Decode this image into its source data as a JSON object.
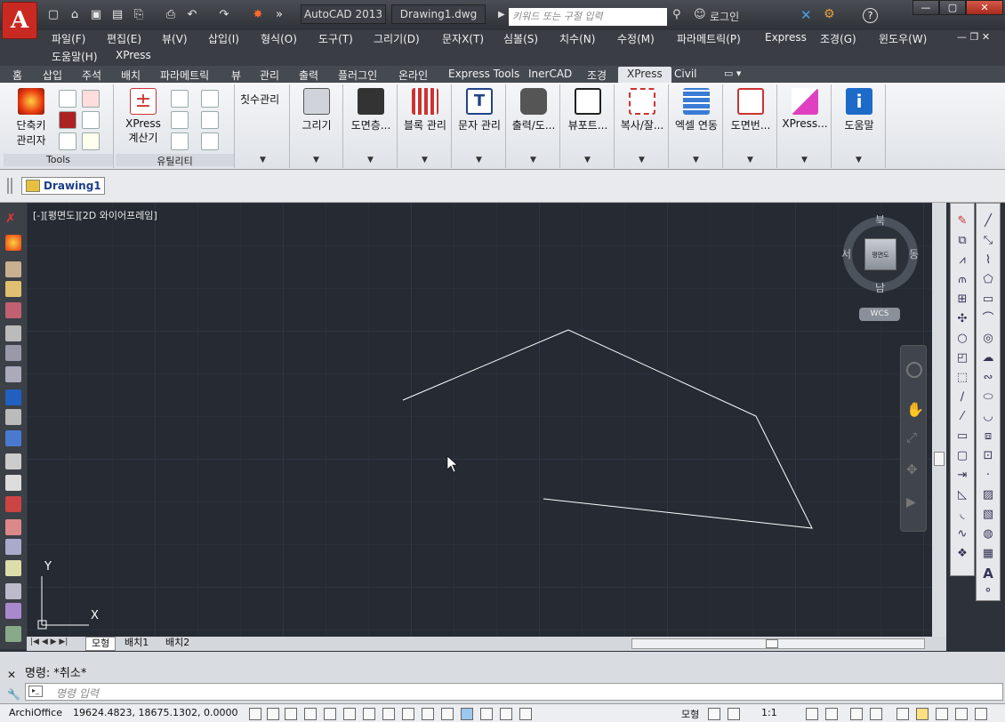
{
  "titlebar": {
    "app_version": "AutoCAD 2013",
    "document": "Drawing1.dwg",
    "search_placeholder": "키워드 또는 구절 입력",
    "login": "로그인",
    "help": "?"
  },
  "menubar": {
    "items": [
      "파일(F)",
      "편집(E)",
      "뷰(V)",
      "삽입(I)",
      "형식(O)",
      "도구(T)",
      "그리기(D)",
      "문자X(T)",
      "심볼(S)",
      "치수(N)",
      "수정(M)",
      "파라메트릭(P)",
      "Express",
      "조경(G)",
      "윈도우(W)",
      "도움말(H)",
      "XPress"
    ]
  },
  "ribbon_tabs": [
    "홈",
    "삽입",
    "주석",
    "배치",
    "파라메트릭",
    "뷰",
    "관리",
    "출력",
    "플러그인",
    "온라인",
    "Express Tools",
    "InerCAD",
    "조경",
    "XPress",
    "Civil"
  ],
  "active_tab": "XPress",
  "ribbon": {
    "tools_panel": {
      "title": "Tools",
      "shortcut_label_1": "단축키",
      "shortcut_label_2": "관리자"
    },
    "utility_panel": {
      "title": "유틸리티",
      "calc_label_1": "XPress",
      "calc_label_2": "계산기"
    },
    "dimension_label": "칫수관리",
    "buttons": [
      "그리기",
      "도면층...",
      "블록 관리",
      "문자 관리",
      "출력/도...",
      "뷰포트...",
      "복사/잘...",
      "엑셀 연동",
      "도면번...",
      "XPress...",
      "도움말"
    ]
  },
  "doc_tab": "Drawing1",
  "viewport": {
    "label": "[-][평면도][2D 와이어프레임]",
    "viewcube": {
      "north": "북",
      "south": "남",
      "east": "동",
      "west": "서",
      "face": "평면도",
      "wcs": "WCS"
    },
    "ucs": {
      "x": "X",
      "y": "Y"
    }
  },
  "layout_tabs": [
    "모형",
    "배치1",
    "배치2"
  ],
  "command": {
    "history": "명령: *취소*",
    "placeholder": "명령 입력"
  },
  "statusbar": {
    "profile": "ArchiOffice",
    "coordinates": "19624.4823, 18675.1302, 0.0000",
    "model": "모형",
    "scale": "1:1"
  },
  "colors": {
    "canvas": "#252a33",
    "ribbon": "#e8ebef",
    "app_button": "#c82a22"
  }
}
